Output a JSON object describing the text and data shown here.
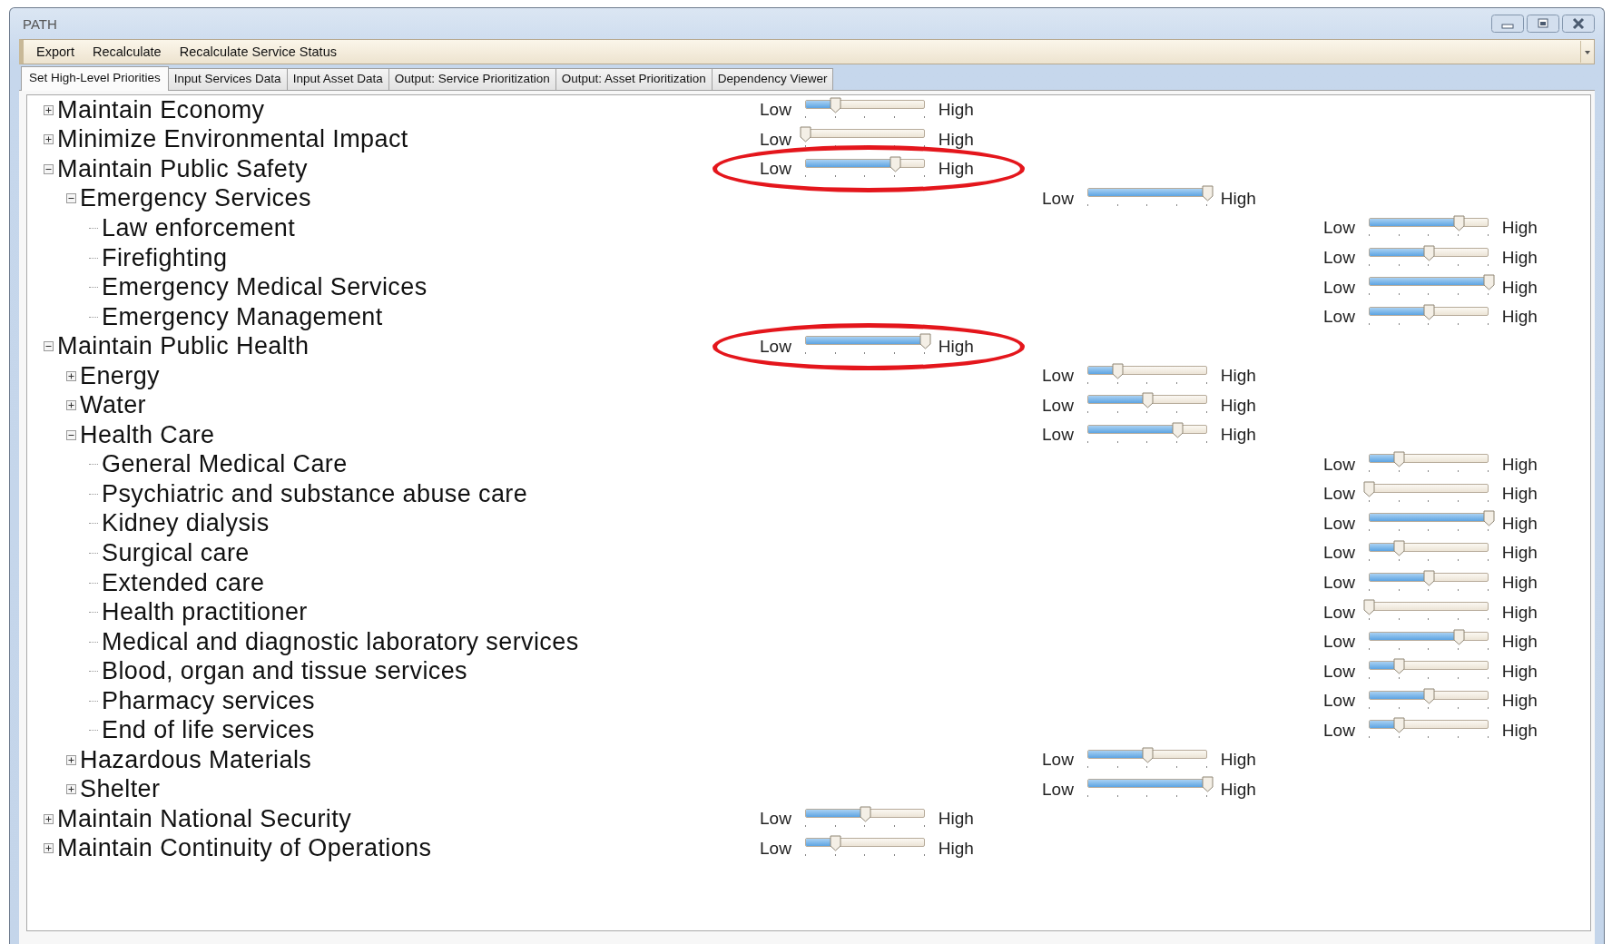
{
  "window": {
    "title": "PATH"
  },
  "menu": [
    "Export",
    "Recalculate",
    "Recalculate Service Status"
  ],
  "tabs": [
    {
      "label": "Set High-Level Priorities",
      "selected": true
    },
    {
      "label": "Input Services Data",
      "selected": false
    },
    {
      "label": "Input Asset Data",
      "selected": false
    },
    {
      "label": "Output: Service Prioritization",
      "selected": false
    },
    {
      "label": "Output: Asset Prioritization",
      "selected": false
    },
    {
      "label": "Dependency Viewer",
      "selected": false
    }
  ],
  "priorities": [
    {
      "label": "Maintain Economy",
      "expanded": false,
      "min_label": "Low",
      "max_label": "High",
      "level": 0.25,
      "highlighted": false
    },
    {
      "label": "Minimize Environmental Impact",
      "expanded": false,
      "min_label": "Low",
      "max_label": "High",
      "level": 0,
      "highlighted": false
    },
    {
      "label": "Maintain Public Safety",
      "expanded": true,
      "min_label": "Low",
      "max_label": "High",
      "level": 0.75,
      "highlighted": true,
      "children": [
        {
          "label": "Emergency Services",
          "expanded": true,
          "min_label": "Low",
          "max_label": "High",
          "level": 1,
          "highlighted": false,
          "children": [
            {
              "label": "Law enforcement",
              "min_label": "Low",
              "max_label": "High",
              "level": 0.75,
              "highlighted": false
            },
            {
              "label": "Firefighting",
              "min_label": "Low",
              "max_label": "High",
              "level": 0.5,
              "highlighted": false
            },
            {
              "label": "Emergency Medical Services",
              "min_label": "Low",
              "max_label": "High",
              "level": 1,
              "highlighted": false
            },
            {
              "label": "Emergency Management",
              "min_label": "Low",
              "max_label": "High",
              "level": 0.5,
              "highlighted": false
            }
          ]
        }
      ]
    },
    {
      "label": "Maintain Public Health",
      "expanded": true,
      "min_label": "Low",
      "max_label": "High",
      "level": 1,
      "highlighted": true,
      "children": [
        {
          "label": "Energy",
          "expanded": false,
          "min_label": "Low",
          "max_label": "High",
          "level": 0.25,
          "highlighted": false
        },
        {
          "label": "Water",
          "expanded": false,
          "min_label": "Low",
          "max_label": "High",
          "level": 0.5,
          "highlighted": false
        },
        {
          "label": "Health Care",
          "expanded": true,
          "min_label": "Low",
          "max_label": "High",
          "level": 0.75,
          "highlighted": false,
          "children": [
            {
              "label": "General Medical Care",
              "min_label": "Low",
              "max_label": "High",
              "level": 0.25,
              "highlighted": false
            },
            {
              "label": "Psychiatric and substance abuse care",
              "min_label": "Low",
              "max_label": "High",
              "level": 0,
              "highlighted": false
            },
            {
              "label": "Kidney dialysis",
              "min_label": "Low",
              "max_label": "High",
              "level": 1,
              "highlighted": false
            },
            {
              "label": "Surgical care",
              "min_label": "Low",
              "max_label": "High",
              "level": 0.25,
              "highlighted": false
            },
            {
              "label": "Extended care",
              "min_label": "Low",
              "max_label": "High",
              "level": 0.5,
              "highlighted": false
            },
            {
              "label": "Health practitioner",
              "min_label": "Low",
              "max_label": "High",
              "level": 0,
              "highlighted": false
            },
            {
              "label": "Medical and diagnostic laboratory services",
              "min_label": "Low",
              "max_label": "High",
              "level": 0.75,
              "highlighted": false
            },
            {
              "label": "Blood, organ and tissue services",
              "min_label": "Low",
              "max_label": "High",
              "level": 0.25,
              "highlighted": false
            },
            {
              "label": "Pharmacy services",
              "min_label": "Low",
              "max_label": "High",
              "level": 0.5,
              "highlighted": false
            },
            {
              "label": "End of life services",
              "min_label": "Low",
              "max_label": "High",
              "level": 0.25,
              "highlighted": false
            }
          ]
        },
        {
          "label": "Hazardous Materials",
          "expanded": false,
          "min_label": "Low",
          "max_label": "High",
          "level": 0.5,
          "highlighted": false
        },
        {
          "label": "Shelter",
          "expanded": false,
          "min_label": "Low",
          "max_label": "High",
          "level": 1,
          "highlighted": false
        }
      ]
    },
    {
      "label": "Maintain National Security",
      "expanded": false,
      "min_label": "Low",
      "max_label": "High",
      "level": 0.5,
      "highlighted": false
    },
    {
      "label": "Maintain Continuity of Operations",
      "expanded": false,
      "min_label": "Low",
      "max_label": "High",
      "level": 0.25,
      "highlighted": false
    }
  ]
}
